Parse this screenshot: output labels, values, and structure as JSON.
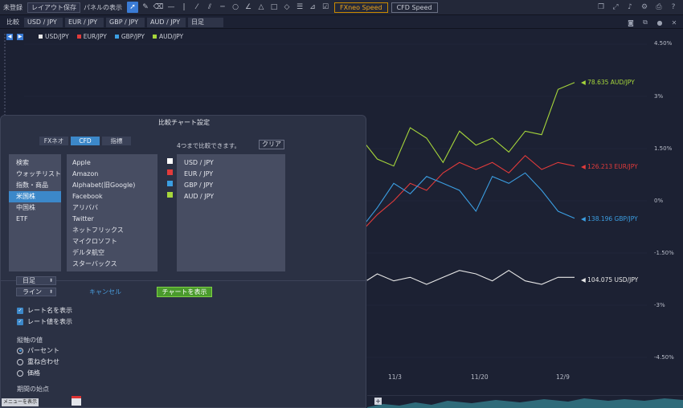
{
  "toolbar": {
    "unsaved": "未登録",
    "save_layout": "レイアウト保存",
    "show_panel": "パネルの表示",
    "fxneo_speed": "FXneo Speed",
    "cfd_speed": "CFD Speed"
  },
  "compare_bar": {
    "label": "比較",
    "slots": [
      "USD / JPY",
      "EUR / JPY",
      "GBP / JPY",
      "AUD / JPY",
      "日足"
    ]
  },
  "colors": {
    "usd": "#e8e8e8",
    "eur": "#e23b3b",
    "gbp": "#3b9ee2",
    "aud": "#a6d63b",
    "accent": "#3c88c9",
    "show_chart_button": "#4a9a2c"
  },
  "chart_data": {
    "type": "line",
    "legend": [
      "USD/JPY",
      "EUR/JPY",
      "GBP/JPY",
      "AUD/JPY"
    ],
    "y_ticks": [
      "4.50%",
      "3%",
      "1.50%",
      "0%",
      "-1.50%",
      "-3%",
      "-4.50%"
    ],
    "x_ticks": [
      "11/3",
      "11/20",
      "12/9"
    ],
    "ylim": [
      -4.5,
      4.5
    ],
    "end_labels": [
      {
        "series": "AUD/JPY",
        "text": "◀ 78.635 AUD/JPY"
      },
      {
        "series": "EUR/JPY",
        "text": "◀ 126.213 EUR/JPY"
      },
      {
        "series": "GBP/JPY",
        "text": "◀ 138.196 GBP/JPY"
      },
      {
        "series": "USD/JPY",
        "text": "◀ 104.075 USD/JPY"
      }
    ],
    "series": [
      {
        "name": "USD/JPY",
        "values": [
          -1.7,
          -1.6,
          -1.4,
          -1.7,
          -1.5,
          -2.4,
          -1.2,
          -1.9,
          -1.4,
          -1.6,
          -1.5,
          -1.5,
          -1.2,
          -1.3,
          -1.6,
          -2.2,
          -2.0,
          -2.4,
          -2.5,
          -1.9,
          -2.4,
          -2.1,
          -2.3,
          -2.2,
          -2.4,
          -2.2,
          -2.0,
          -2.1,
          -2.3,
          -2.0,
          -2.3,
          -2.4,
          -2.2,
          -2.2
        ]
      },
      {
        "name": "EUR/JPY",
        "values": [
          -1.9,
          -1.6,
          -1.8,
          -1.5,
          -1.9,
          -1.2,
          -0.4,
          -0.6,
          -1.0,
          -0.6,
          -0.3,
          -0.6,
          -0.9,
          -0.5,
          -0.3,
          -0.4,
          -0.1,
          -0.8,
          -1.2,
          -0.6,
          -0.9,
          -0.4,
          0.0,
          0.5,
          0.3,
          0.8,
          1.1,
          0.9,
          1.1,
          0.8,
          1.3,
          0.9,
          1.1,
          1.0
        ]
      },
      {
        "name": "GBP/JPY",
        "values": [
          -1.8,
          -1.5,
          -1.4,
          -1.7,
          -1.1,
          -1.4,
          -0.7,
          -1.5,
          -1.0,
          -0.6,
          -0.4,
          -0.8,
          -0.7,
          -0.4,
          -0.1,
          -0.6,
          -0.2,
          -0.6,
          -0.9,
          -0.5,
          -0.8,
          -0.2,
          0.5,
          0.2,
          0.7,
          0.5,
          0.3,
          -0.3,
          0.7,
          0.5,
          0.8,
          0.3,
          -0.3,
          -0.5
        ]
      },
      {
        "name": "AUD/JPY",
        "values": [
          -2.2,
          -1.4,
          -0.6,
          -1.8,
          -1.0,
          -3.0,
          -1.4,
          -2.2,
          -0.3,
          -0.1,
          -0.6,
          -0.3,
          0.3,
          0.6,
          -0.1,
          -0.3,
          -0.6,
          0.0,
          0.3,
          0.8,
          1.8,
          1.2,
          1.0,
          2.1,
          1.8,
          1.1,
          2.0,
          1.6,
          1.8,
          1.4,
          2.0,
          1.9,
          3.2,
          3.4
        ]
      }
    ]
  },
  "dialog": {
    "title": "比較チャート設定",
    "tabs": [
      "FXネオ",
      "CFD",
      "指標"
    ],
    "note": "4つまで比較できます。",
    "clear": "クリア",
    "categories": [
      "検索",
      "ウォッチリスト",
      "指数・商品",
      "米国株",
      "中国株",
      "ETF"
    ],
    "symbols": [
      "Apple",
      "Amazon",
      "Alphabet(旧Google)",
      "Facebook",
      "アリババ",
      "Twitter",
      "ネットフリックス",
      "マイクロソフト",
      "デルタ航空",
      "スターバックス"
    ],
    "selected": [
      "USD / JPY",
      "EUR / JPY",
      "GBP / JPY",
      "AUD / JPY"
    ],
    "period": "日足",
    "chart_style": "ライン",
    "cancel": "キャンセル",
    "show_chart": "チャートを表示",
    "show_rate_name": "レート名を表示",
    "show_rate_value": "レート値を表示",
    "y_axis_label": "縦軸の値",
    "y_axis_options": [
      "パーセント",
      "重ね合わせ",
      "価格"
    ],
    "period_start_label": "期間の始点"
  },
  "menu_button": "メニューを表示"
}
